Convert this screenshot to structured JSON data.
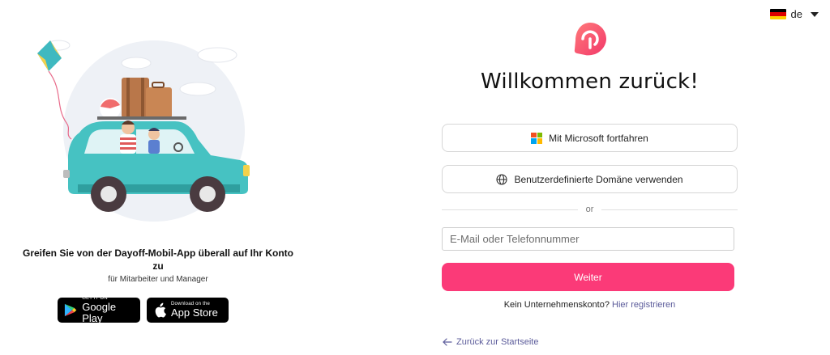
{
  "language": {
    "code": "de",
    "flag_colors": [
      "#000000",
      "#dd0000",
      "#ffce00"
    ]
  },
  "promo": {
    "title": "Greifen Sie von der Dayoff-Mobil-App überall auf Ihr Konto zu",
    "subtitle": "für Mitarbeiter und Manager",
    "google_play": {
      "small": "GET IT ON",
      "big": "Google Play",
      "icon": "google-play-icon"
    },
    "app_store": {
      "small": "Download on the",
      "big": "App Store",
      "icon": "apple-icon"
    }
  },
  "login": {
    "logo_icon": "dayoff-logo",
    "title": "Willkommen zurück!",
    "microsoft_label": "Mit Microsoft fortfahren",
    "domain_label": "Benutzerdefinierte Domäne verwenden",
    "divider_label": "or",
    "email_placeholder": "E-Mail oder Telefonnummer",
    "email_value": "",
    "next_label": "Weiter",
    "no_account_text": "Kein Unternehmenskonto?",
    "register_link": "Hier registrieren",
    "back_label": "Zurück zur Startseite"
  },
  "colors": {
    "accent": "#fb3a78",
    "link": "#5b5b9a",
    "car": "#46c2c2"
  }
}
